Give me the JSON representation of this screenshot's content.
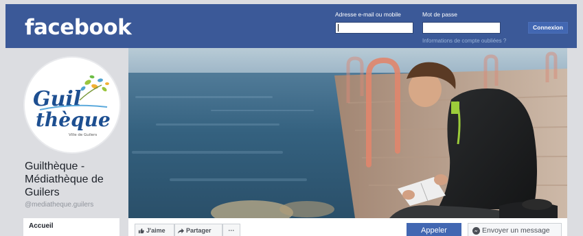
{
  "header": {
    "logo": "facebook",
    "email_label": "Adresse e-mail ou mobile",
    "password_label": "Mot de passe",
    "login_button": "Connexion",
    "forgot_link": "Informations de compte oubliées ?"
  },
  "profile": {
    "logo_line1": "Guil",
    "logo_line2": "thèque",
    "logo_caption": "Ville de Guilers",
    "page_name": "Guilthèque - Médiathèque de Guilers",
    "handle": "@mediatheque.guilers"
  },
  "sidebar": {
    "items": [
      {
        "label": "Accueil"
      }
    ]
  },
  "actions": {
    "like": "J'aime",
    "share": "Partager",
    "more": "···",
    "call": "Appeler",
    "message": "Envoyer un message"
  },
  "colors": {
    "brand": "#3b5998",
    "button": "#4267b2"
  }
}
